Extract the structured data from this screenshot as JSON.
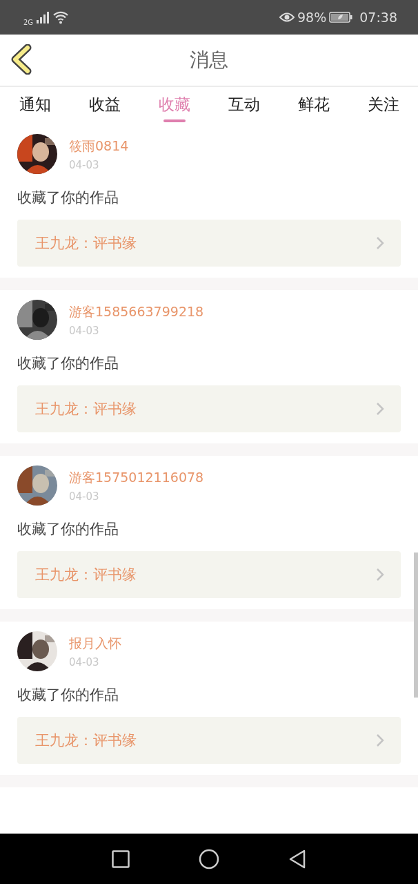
{
  "status_bar": {
    "network": "2G",
    "battery": "98%",
    "time": "07:38"
  },
  "header": {
    "title": "消息"
  },
  "tabs": [
    {
      "label": "通知",
      "selected": false
    },
    {
      "label": "收益",
      "selected": false
    },
    {
      "label": "收藏",
      "selected": true
    },
    {
      "label": "互动",
      "selected": false
    },
    {
      "label": "鲜花",
      "selected": false
    },
    {
      "label": "关注",
      "selected": false
    }
  ],
  "messages": [
    {
      "user": "筱雨0814",
      "date": "04-03",
      "text": "收藏了你的作品",
      "work": "王九龙：评书缘"
    },
    {
      "user": "游客1585663799218",
      "date": "04-03",
      "text": "收藏了你的作品",
      "work": "王九龙：评书缘"
    },
    {
      "user": "游客1575012116078",
      "date": "04-03",
      "text": "收藏了你的作品",
      "work": "王九龙：评书缘"
    },
    {
      "user": "报月入怀",
      "date": "04-03",
      "text": "收藏了你的作品",
      "work": "王九龙：评书缘"
    }
  ]
}
